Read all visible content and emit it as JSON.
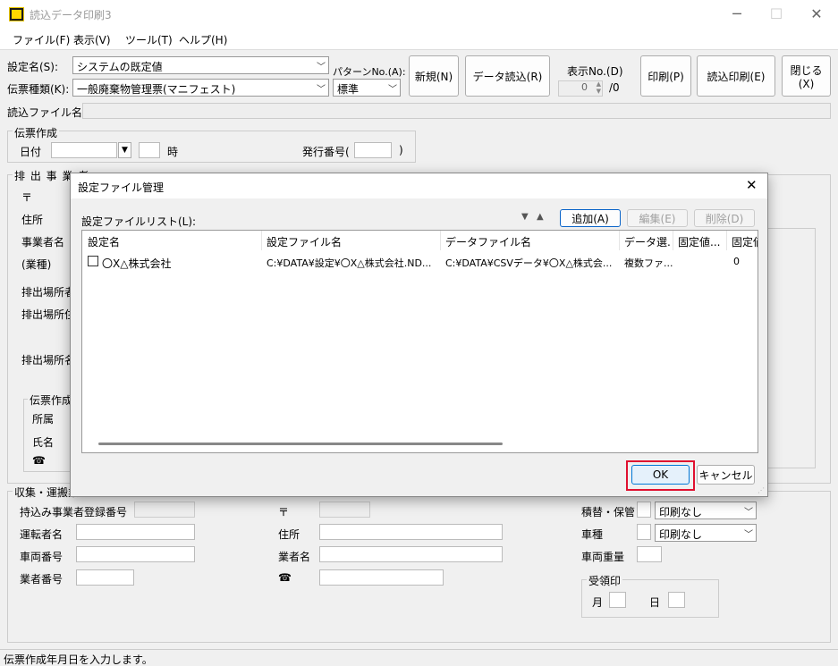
{
  "window": {
    "title": "読込データ印刷3"
  },
  "menu": [
    "ファイル(F)",
    "表示(V)",
    "ツール(T)",
    "ヘルプ(H)"
  ],
  "toolbar": {
    "setting_name_label": "設定名(S):",
    "setting_name_value": "システムの既定値",
    "slip_type_label": "伝票種類(K):",
    "slip_type_value": "一般廃棄物管理票(マニフェスト)",
    "pattern_label": "パターンNo.(A):",
    "pattern_value": "標準",
    "new_button": "新規(N)",
    "data_read_button": "データ読込(R)",
    "display_no_label": "表示No.(D)",
    "display_no_value": "0",
    "display_no_total": "/0",
    "print_button": "印刷(P)",
    "read_print_button": "読込印刷(E)",
    "close_button": "閉じる(X)",
    "read_file_label": "読込ファイル名"
  },
  "slip_creation": {
    "group_label": "伝票作成",
    "date_label": "日付",
    "hour_label": "時",
    "issue_no_label": "発行番号(",
    "issue_no_close": ")"
  },
  "emitter": {
    "group_label": "排 出 事 業 者",
    "postal_label": "〒",
    "address_label": "住所",
    "company_label": "事業者名",
    "industry_label": "(業種)",
    "site_label1": "排出場所者",
    "site_label2": "排出場所住",
    "site_label3": "排出場所名",
    "creator_group": "伝票作成",
    "dept_label": "所属",
    "name_label": "氏名",
    "phone_icon": "☎"
  },
  "transport": {
    "group_label": "収集・運搬業",
    "reg_no_label": "持込み事業者登録番号",
    "driver_label": "運転者名",
    "vehicle_no_label": "車両番号",
    "company_no_label": "業者番号",
    "postal_label": "〒",
    "address_label": "住所",
    "company_label": "業者名",
    "phone_icon": "☎",
    "transship_label": "積替・保管",
    "transship_value": "印刷なし",
    "vehicle_type_label": "車種",
    "vehicle_type_value": "印刷なし",
    "vehicle_weight_label": "車両重量",
    "receipt_group": "受領印",
    "month_label": "月",
    "day_label": "日"
  },
  "dialog": {
    "title": "設定ファイル管理",
    "list_label": "設定ファイルリスト(L):",
    "add_button": "追加(A)",
    "edit_button": "編集(E)",
    "delete_button": "削除(D)",
    "columns": [
      "設定名",
      "設定ファイル名",
      "データファイル名",
      "データ選...",
      "固定値...",
      "固定値"
    ],
    "rows": [
      [
        "〇X△株式会社",
        "C:¥DATA¥設定¥〇X△株式会社.ND...",
        "C:¥DATA¥CSVデータ¥〇X△株式会...",
        "複数ファ...",
        "",
        "0"
      ]
    ],
    "ok_button": "OK",
    "cancel_button": "キャンセル",
    "highlight_color": "#e0102f"
  },
  "status_bar": {
    "text": "伝票作成年月日を入力します。"
  }
}
